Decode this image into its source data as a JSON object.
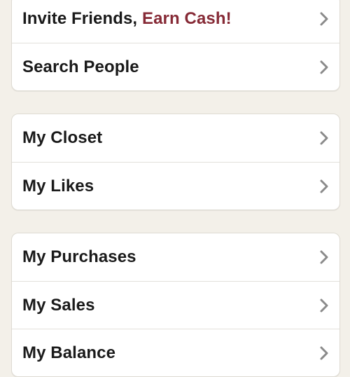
{
  "menu": {
    "groups": [
      {
        "items": [
          {
            "label": "Invite Friends, ",
            "highlight": "Earn Cash!"
          },
          {
            "label": "Search People"
          }
        ]
      },
      {
        "items": [
          {
            "label": "My Closet"
          },
          {
            "label": "My Likes"
          }
        ]
      },
      {
        "items": [
          {
            "label": "My Purchases"
          },
          {
            "label": "My Sales"
          },
          {
            "label": "My Balance"
          }
        ]
      }
    ]
  },
  "colors": {
    "background": "#f3f0e9",
    "card": "#ffffff",
    "text": "#1a1a1a",
    "highlight": "#862a36",
    "chevron": "#8a8a8a"
  },
  "icons": {
    "row_disclosure": "chevron-right-icon"
  }
}
